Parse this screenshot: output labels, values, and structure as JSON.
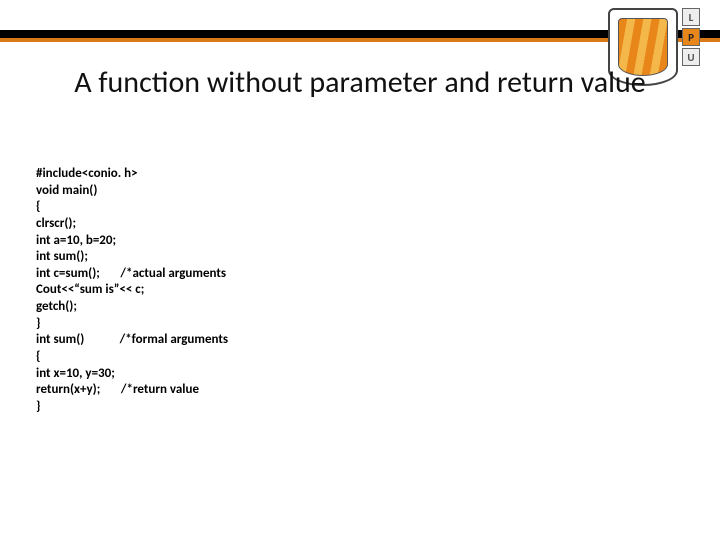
{
  "header": {
    "title": "A function without parameter and return value",
    "side_letters": [
      "L",
      "P",
      "U"
    ]
  },
  "code": {
    "l1": "#include<conio. h>",
    "l2": "void main()",
    "l3": "{",
    "l4": "clrscr();",
    "l5": "int a=10, b=20;",
    "l6": "int sum();",
    "l7a": "int c=sum();",
    "l7b": "/*actual arguments",
    "l8": "Cout<<“sum is”<< c;",
    "l9": "getch();",
    "l10": "}",
    "l11a": "int sum()",
    "l11b": "/*formal arguments",
    "l12": "{",
    "l13": "int x=10, y=30;",
    "l14a": "return(x+y);",
    "l14b": "/*return value",
    "l15": "}"
  }
}
